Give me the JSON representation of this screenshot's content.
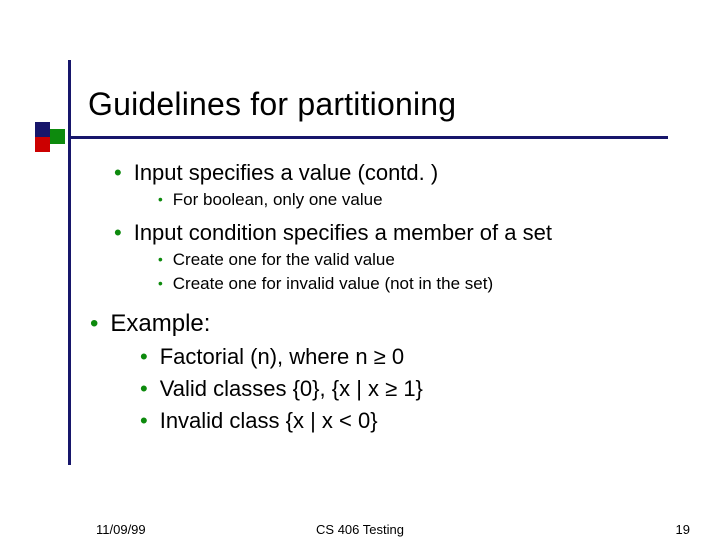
{
  "title": "Guidelines for partitioning",
  "bullets": {
    "l1a": "Input specifies a value (contd. )",
    "l1a_sub1": "For boolean, only one value",
    "l1b": "Input condition specifies a member of a set",
    "l1b_sub1": "Create one for the valid value",
    "l1b_sub2": "Create one for invalid value (not in the set)",
    "l1c": "Example:",
    "l1c_sub1": "Factorial (n), where n ≥ 0",
    "l1c_sub2": "Valid classes {0}, {x | x ≥ 1}",
    "l1c_sub3": "Invalid class {x | x < 0}"
  },
  "footer": {
    "date": "11/09/99",
    "course": "CS 406 Testing",
    "page": "19"
  },
  "colors": {
    "accent_navy": "#17166b",
    "accent_red": "#cc0000",
    "accent_green": "#0d8a0d"
  }
}
